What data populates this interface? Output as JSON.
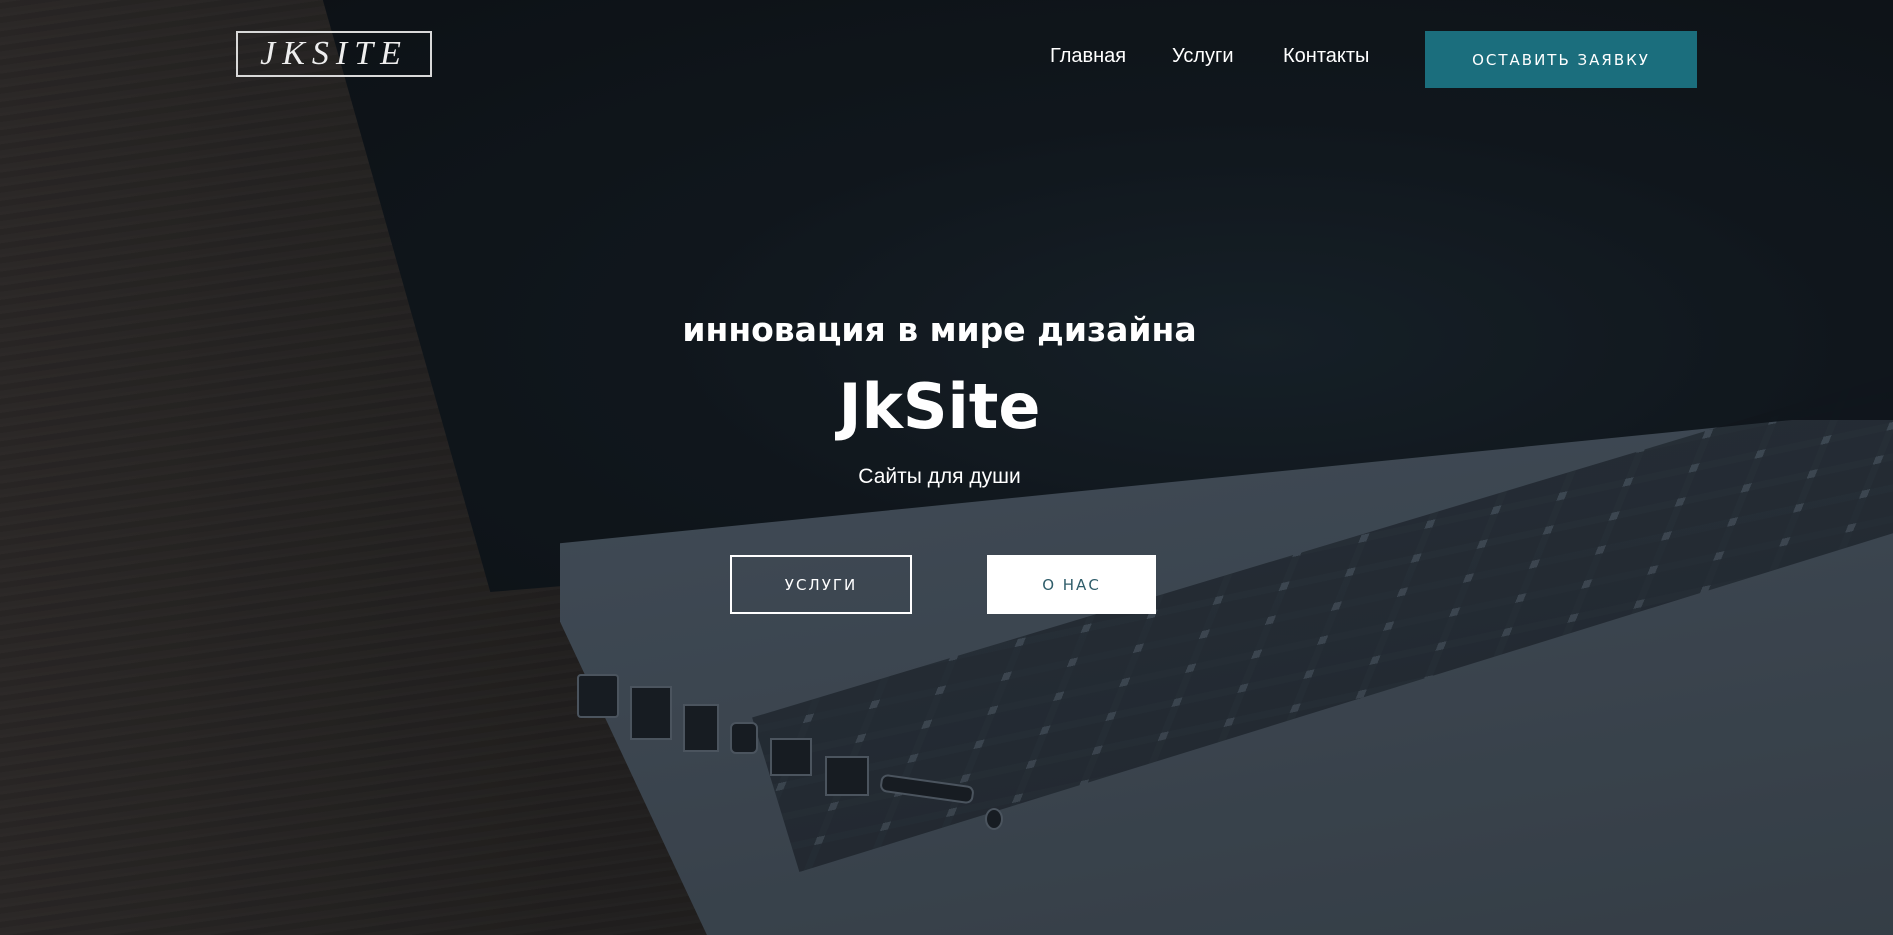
{
  "header": {
    "logo_text": "JKSITE",
    "nav": [
      "Главная",
      "Услуги",
      "Контакты"
    ],
    "cta_label": "ОСТАВИТЬ ЗАЯВКУ"
  },
  "hero": {
    "tagline": "инновация в мире дизайна",
    "title": "JkSite",
    "subtitle": "Сайты для души",
    "buttons": {
      "services": "УСЛУГИ",
      "about": "О НАС"
    }
  },
  "colors": {
    "accent": "#1b6e7d",
    "background": "#14171b"
  }
}
